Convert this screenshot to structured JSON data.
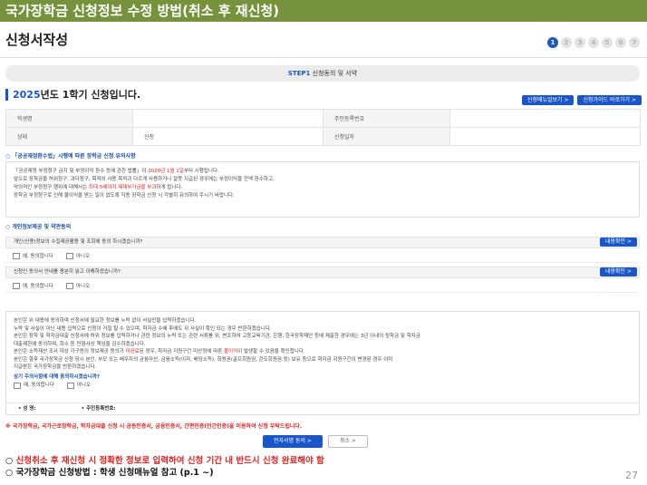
{
  "banner": {
    "title": "국가장학금 신청정보 수정 방법(취소 후 재신청)"
  },
  "app": {
    "title": "신청서작성"
  },
  "steps": [
    "1",
    "2",
    "3",
    "4",
    "5",
    "6",
    "7"
  ],
  "active_step": "1",
  "step_bar": {
    "num": "STEP1",
    "label": " 신청동의 및 서약"
  },
  "semester": {
    "year": "2025",
    "rest": "년도 1학기 신청입니다."
  },
  "buttons": {
    "manual": "신청매뉴얼보기 >",
    "guide": "신청가이드 바로가기 >"
  },
  "info_table": {
    "row1": {
      "label1": "학생명",
      "value1": "",
      "label2": "주민등록번호",
      "value2": ""
    },
    "row2": {
      "label1": "상태",
      "value1": "신청",
      "label2": "신청일자",
      "value2": ""
    }
  },
  "notice": {
    "head": "「공공재정환수법」시행에 따른 장학금 신청 유의사항",
    "l1a": "「공공재정 부정청구 금지 및 부정이익 환수 등에 관한 법률」이 ",
    "l1b": "2020년 1월 1일",
    "l1c": "부터 시행됩니다.",
    "l2": "앞으로 장학금을 허위청구, 과다청구, 목적외 사용 목적과 다르게 사용하거나 잘못 지급된 경우에는 부정이익을 전액 환수하고,",
    "l3a": "악의적인 부정청구 행위에 대해서는 ",
    "l3b": "최대 5배까지 제재부가금을 부과",
    "l3c": "하게 됩니다.",
    "l4": "장학금 부정청구로 인해 불이익을 받는 일이 없도록 각종 장학금 신청 시 각별히 유의하여 주시기 바랍니다."
  },
  "terms": {
    "head": "개인정보제공 및 약관동의",
    "q1": "개인(신용)정보의 수집제공활용 및 조회에 동의 하시겠습니까?",
    "q2": "신청인 동의서 안내를 충분히 읽고 이해하셨습니까?",
    "confirm": "내용확인 >",
    "yes": "예, 동의합니다",
    "no": "아니오"
  },
  "consent": {
    "l1": "본인은 위 내용에 동의하며 신청서에 필요한 정보를 누락 없이 사실만을 입력하겠습니다.",
    "l2": "누락 및 사실이 아닌 내용 입력으로 신청이 거절 될 수 있으며, 학자금 수혜 후에도 위 사실이 확인 되는 경우 반환하겠습니다.",
    "l3": "본인은 장학 및 학자금대출 신청서에 허위 정보를 입력하거나 관련 정보의 누락 또는 관련 서류를 위, 변조하여 고등교육기관, 은행, 한국장학재단 등에 제출한 경우에는 3년 이내의 장학금 및 학자금",
    "l4": "대출제한에 동의하며, 회수 등 민형사상 책임을 감수하겠습니다.",
    "l5a": "본인은 소득재산 조사 대상 가구원의 정보제공 동의가 ",
    "l5b": "미완료",
    "l5c": "된 경우, 학자금 지원구간 미산정에 따른 ",
    "l5d": "불이익",
    "l5e": "이 발생할 수 있음을 확인합니다.",
    "l6": "본인은 향후 국가장학금 신청 당시 본인, 부모 또는 배우자의 금융자산, 금융소득(이자, 배당소득), 회원권(골프회원권, 콘도회원권 등) 보유 등으로 학자금 지원구간이 변경된 경우 이미",
    "l7": "지급받은 국가장학금을 반환하겠습니다.",
    "question": "상기 주의사항에 대해 동의하시겠습니까?",
    "yes": "예, 동의합니다",
    "no": "아니오",
    "name_label": "• 성 명:",
    "rrn_label": "• 주민등록번호:"
  },
  "warning": "※ 국가장학금, 국가근로장학금, 학자금대출 신청 시 공동인증서, 금융인증서, 간편인증(민간인증)을 이용하여 신청 부탁드립니다.",
  "actions": {
    "sign": "전자서명 동의 >",
    "cancel": "취소 >"
  },
  "bottom": {
    "line1_prefix": "○ ",
    "line1": "신청취소 후 재신청 시 정확한 정보로 입력하여 신청 기간 내 반드시 신청 완료해야 함",
    "line2": "○ 국가장학금 신청방법 : 학생 신청매뉴얼 참고 (p.1 ~)"
  },
  "page_number": "27",
  "colors": {
    "banner": "#76923c",
    "accent": "#1b56c8",
    "red": "#d22222"
  }
}
